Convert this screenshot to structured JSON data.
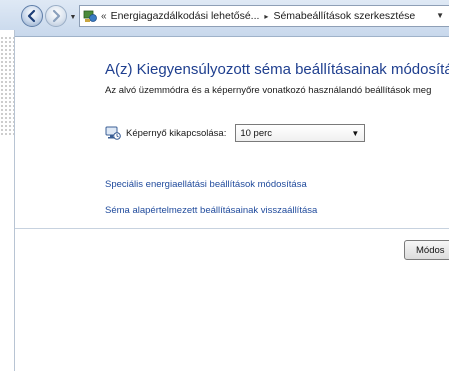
{
  "addressbar": {
    "overflow_chevron": "«",
    "breadcrumb": [
      {
        "label": "Energiagazdálkodási lehetősé..."
      },
      {
        "label": "Sémabeállítások szerkesztése"
      }
    ],
    "breadcrumb_separator": "▸",
    "dropdown_arrow": "▼"
  },
  "icons": {
    "back": "back-arrow-icon",
    "forward": "forward-arrow-icon",
    "control_panel": "control-panel-icon",
    "monitor": "monitor-power-icon"
  },
  "main": {
    "title": "A(z) Kiegyensúlyozott séma beállításainak módosítása",
    "subtitle": "Az alvó üzemmódra és a képernyőre vonatkozó használandó beállítások meg",
    "display_off": {
      "label": "Képernyő kikapcsolása:",
      "value": "10 perc"
    },
    "links": [
      {
        "label": "Speciális energiaellátási beállítások módosítása"
      },
      {
        "label": "Séma alapértelmezett beállításainak visszaállítása"
      }
    ],
    "save_button_label": "Módos"
  },
  "colors": {
    "title": "#1f3f8f",
    "link": "#1f4a9c"
  }
}
